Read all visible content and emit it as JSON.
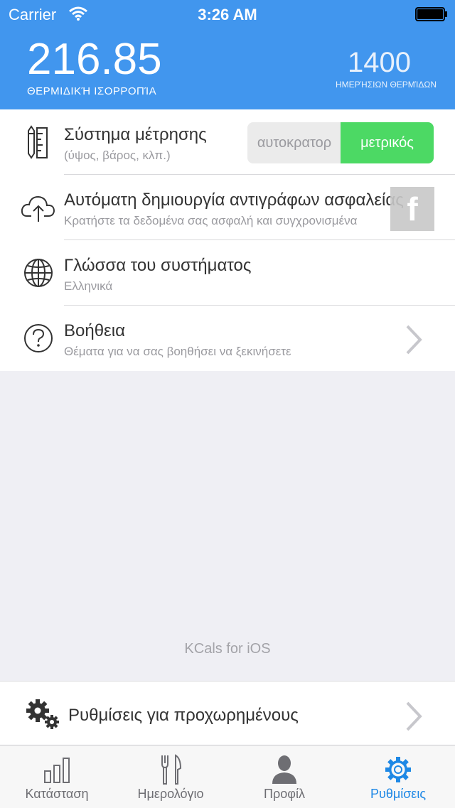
{
  "status_bar": {
    "carrier": "Carrier",
    "time": "3:26 AM"
  },
  "header": {
    "balance_value": "216.85",
    "balance_label": "ΘΕΡΜΙΔΙΚΉ ΙΣΟΡΡΟΠΊΑ",
    "daily_value": "1400",
    "daily_label": "ΗΜΕΡΉΣΙΩΝ ΘΕΡΜΊΔΩΝ"
  },
  "settings": {
    "rows": [
      {
        "title": "Σύστημα μέτρησης",
        "subtitle": "(ύψος, βάρος, κλπ.)",
        "options": [
          "αυτοκρατορ",
          "μετρικός"
        ],
        "selected": "μετρικός",
        "icon": "pencil-ruler-icon"
      },
      {
        "title": "Αυτόματη δημιουργία αντιγράφων ασφαλείας",
        "subtitle": "Κρατήστε τα δεδομένα σας ασφαλή και συγχρονισμένα",
        "icon": "cloud-upload-icon"
      },
      {
        "title": "Γλώσσα του συστήματος",
        "subtitle": "Ελληνικά",
        "icon": "globe-icon"
      },
      {
        "title": "Βοήθεια",
        "subtitle": "Θέματα για να σας βοηθήσει να ξεκινήσετε",
        "icon": "help-circle-icon"
      }
    ]
  },
  "footer_note": "KCals for iOS",
  "advanced": {
    "title": "Ρυθμίσεις για προχωρημένους",
    "icon": "gears-icon"
  },
  "facebook": {
    "glyph": "f",
    "icon": "facebook-icon"
  },
  "tabs": [
    {
      "label": "Κατάσταση",
      "icon": "bar-chart-icon"
    },
    {
      "label": "Ημερολόγιο",
      "icon": "fork-knife-icon"
    },
    {
      "label": "Προφίλ",
      "icon": "person-icon"
    },
    {
      "label": "Ρυθμίσεις",
      "icon": "gear-icon",
      "active": true
    }
  ],
  "colors": {
    "header": "#4196ee",
    "toggle_active": "#4cd964",
    "tab_active": "#1e88e5"
  }
}
